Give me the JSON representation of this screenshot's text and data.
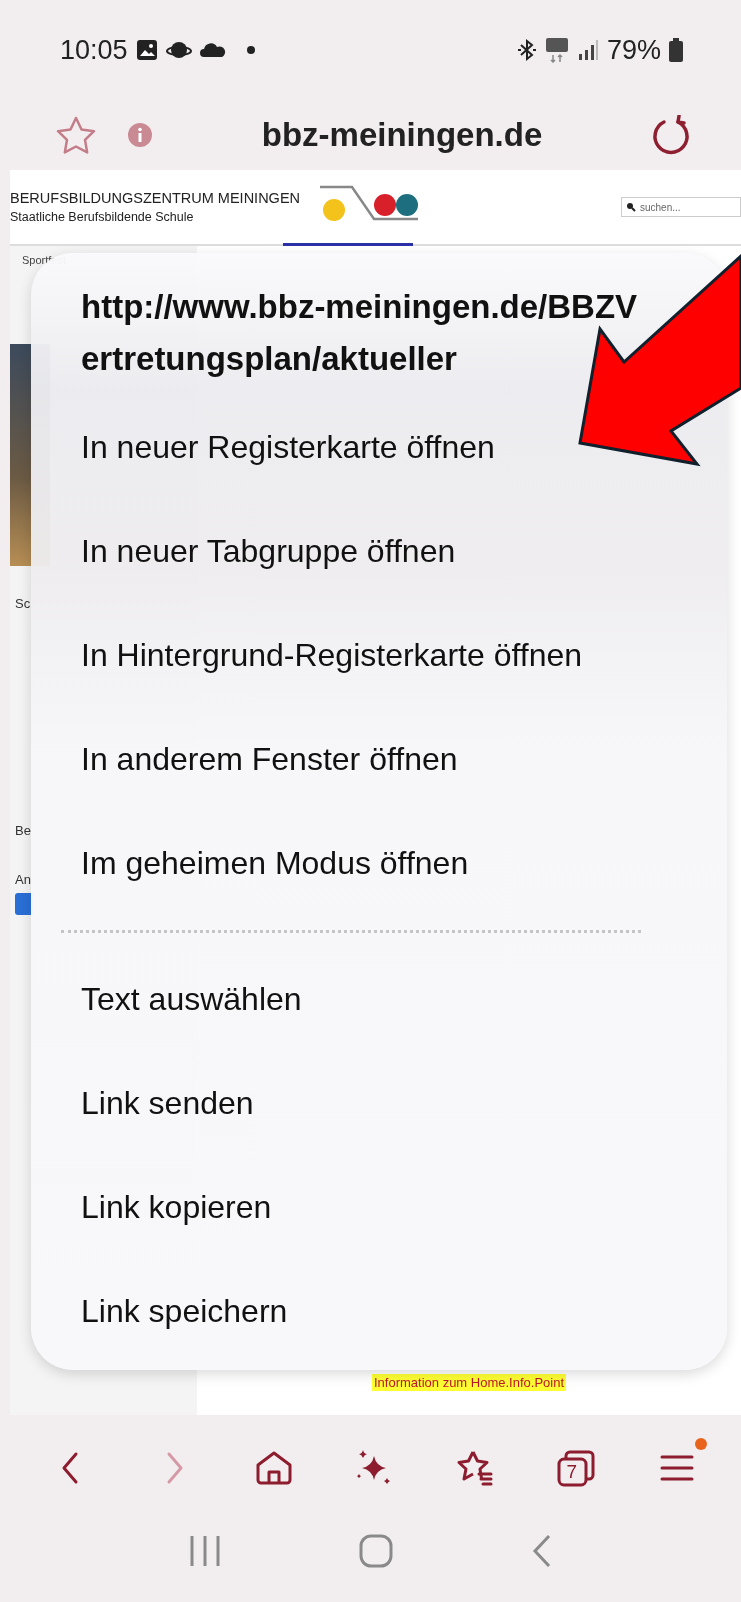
{
  "status_bar": {
    "time": "10:05",
    "battery": "79%"
  },
  "address_bar": {
    "domain": "bbz-meiningen.de"
  },
  "web_page": {
    "site_title": "BERUFSBILDUNGSZENTRUM MEININGEN",
    "site_subtitle": "Staatliche Berufsbildende Schule",
    "search": {
      "placeholder": "suchen..."
    },
    "fragments": [
      "Sportfest",
      "Sc",
      "Be",
      "An"
    ],
    "notice": "Information zum Home.Info.Point"
  },
  "context_menu": {
    "url": "http://www.bbz-meiningen.de/BBZVertretungsplan/aktueller",
    "groups": [
      [
        "In neuer Registerkarte öffnen",
        "In neuer Tabgruppe öffnen",
        "In Hintergrund-Registerkarte öffnen",
        "In anderem Fenster öffnen",
        "Im geheimen Modus öffnen"
      ],
      [
        "Text auswählen",
        "Link senden",
        "Link kopieren",
        "Link speichern"
      ]
    ]
  },
  "toolbar": [
    {
      "kind": "back",
      "disabled": false,
      "badge": false
    },
    {
      "kind": "forward",
      "disabled": true,
      "badge": false
    },
    {
      "kind": "home",
      "disabled": false,
      "badge": false
    },
    {
      "kind": "sparkle",
      "disabled": false,
      "badge": false
    },
    {
      "kind": "bookmarks",
      "disabled": false,
      "badge": false
    },
    {
      "kind": "tabs",
      "count": "7",
      "disabled": false,
      "badge": false
    },
    {
      "kind": "menu",
      "disabled": false,
      "badge": true
    }
  ]
}
